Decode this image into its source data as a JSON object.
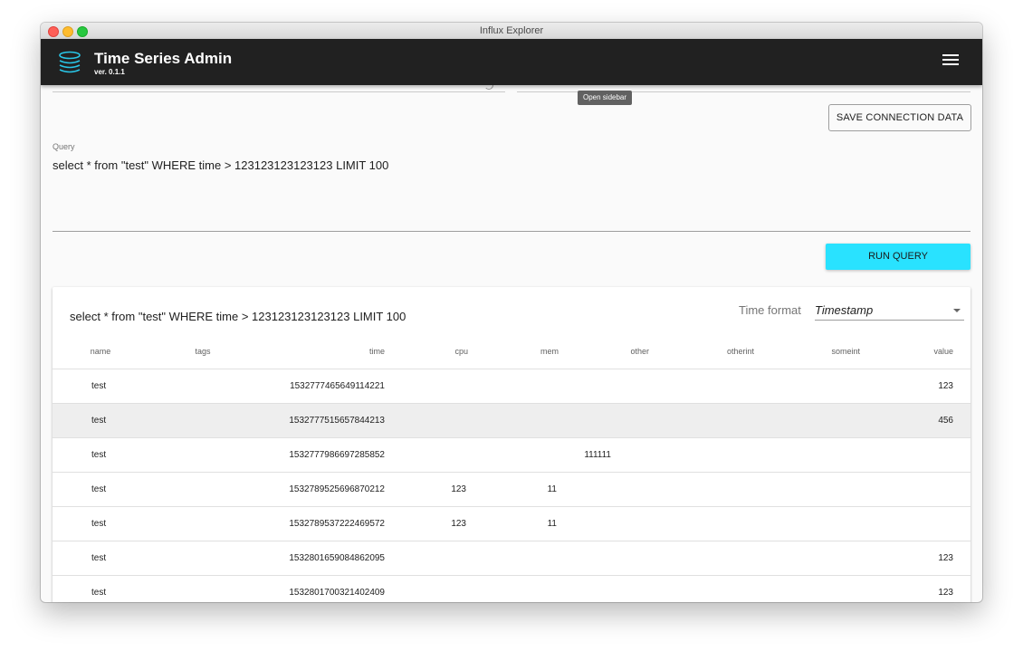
{
  "window": {
    "title": "Influx Explorer"
  },
  "appbar": {
    "title": "Time Series Admin",
    "version": "ver. 0.1.1",
    "menu_icon": "hamburger-menu-icon",
    "logo_icon": "database-icon"
  },
  "tooltip": {
    "text": "Open sidebar"
  },
  "connection": {
    "save_label": "SAVE CONNECTION DATA"
  },
  "query": {
    "label": "Query",
    "value": "select * from \"test\" WHERE time > 123123123123123 LIMIT 100",
    "run_label": "RUN QUERY"
  },
  "results": {
    "title": "select * from \"test\" WHERE time > 123123123123123 LIMIT 100",
    "time_format_label": "Time format",
    "time_format_value": "Timestamp",
    "columns": [
      "name",
      "tags",
      "time",
      "cpu",
      "mem",
      "other",
      "otherint",
      "someint",
      "value"
    ],
    "rows": [
      [
        "test",
        "",
        "1532777465649114221",
        "",
        "",
        "",
        "",
        "",
        "123"
      ],
      [
        "test",
        "",
        "1532777515657844213",
        "",
        "",
        "",
        "",
        "",
        "456"
      ],
      [
        "test",
        "",
        "1532777986697285852",
        "",
        "",
        "111111",
        "",
        "",
        ""
      ],
      [
        "test",
        "",
        "1532789525696870212",
        "123",
        "11",
        "",
        "",
        "",
        ""
      ],
      [
        "test",
        "",
        "1532789537222469572",
        "123",
        "11",
        "",
        "",
        "",
        ""
      ],
      [
        "test",
        "",
        "1532801659084862095",
        "",
        "",
        "",
        "",
        "",
        "123"
      ],
      [
        "test",
        "",
        "1532801700321402409",
        "",
        "",
        "",
        "",
        "",
        "123"
      ]
    ]
  },
  "colors": {
    "appbar": "#212121",
    "accent": "#29e2ff",
    "highlight_row": "#eeeeee"
  }
}
